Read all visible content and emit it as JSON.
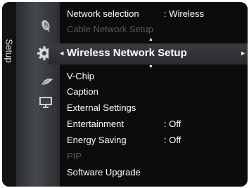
{
  "tab": {
    "label": "Setup"
  },
  "menu": {
    "above": [
      {
        "label": "Network selection",
        "value": ": Wireless",
        "enabled": true
      },
      {
        "label": "Cable Network Setup",
        "value": "",
        "enabled": false
      }
    ],
    "selected": {
      "label": "Wireless Network Setup"
    },
    "below": [
      {
        "label": "V-Chip",
        "value": "",
        "enabled": true
      },
      {
        "label": "Caption",
        "value": "",
        "enabled": true
      },
      {
        "label": "External Settings",
        "value": "",
        "enabled": true
      },
      {
        "label": "Entertainment",
        "value": ": Off",
        "enabled": true
      },
      {
        "label": "Energy Saving",
        "value": ": Off",
        "enabled": true
      },
      {
        "label": "PIP",
        "value": "",
        "enabled": false
      },
      {
        "label": "Software Upgrade",
        "value": "",
        "enabled": true
      }
    ]
  },
  "icons": [
    "satellite-dish-icon",
    "gear-icon",
    "leaf-icon",
    "monitor-icon"
  ],
  "colors": {
    "panel": "#0c0c0d",
    "text": "#ffffff",
    "disabled_text": "#5a5b5e",
    "highlight": "#3a3c40"
  }
}
